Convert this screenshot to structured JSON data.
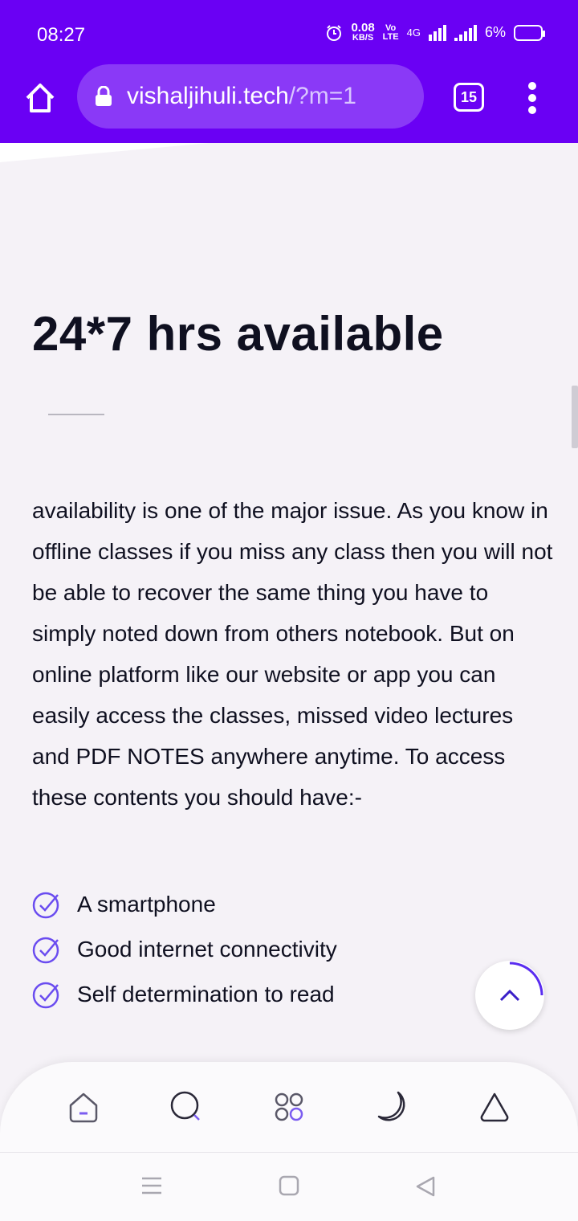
{
  "status_bar": {
    "time": "08:27",
    "speed_value": "0.08",
    "speed_unit": "KB/S",
    "volte_top": "Vo",
    "volte_bottom": "LTE",
    "network": "4G",
    "battery": "6%"
  },
  "browser": {
    "url_host": "vishaljihuli.tech",
    "url_path": "/?m=1",
    "tab_count": "15"
  },
  "content": {
    "heading": "24*7 hrs available",
    "paragraph": "availability is one of the major issue. As you know in offline classes if you miss any class then you will not be able to recover the same thing you have to simply noted down from others notebook. But on online platform like our website or app you can easily access the classes, missed video lectures and PDF NOTES anywhere anytime. To access these contents you should have:-",
    "list_items": [
      "A smartphone",
      "Good internet connectivity",
      "Self determination to read"
    ]
  },
  "colors": {
    "brand": "#6a00f4",
    "url_bar": "#8a39f7",
    "check_icon": "#6a4cf0"
  },
  "icons": {
    "toolbar": [
      "home-icon",
      "lock-icon",
      "tabs-icon",
      "more-vert-icon"
    ],
    "bottom_nav": [
      "home-icon",
      "search-icon",
      "apps-icon",
      "moon-icon",
      "shape-icon"
    ],
    "system_nav": [
      "recents-icon",
      "home-square-icon",
      "back-icon"
    ],
    "floating": "chevron-up-icon"
  }
}
